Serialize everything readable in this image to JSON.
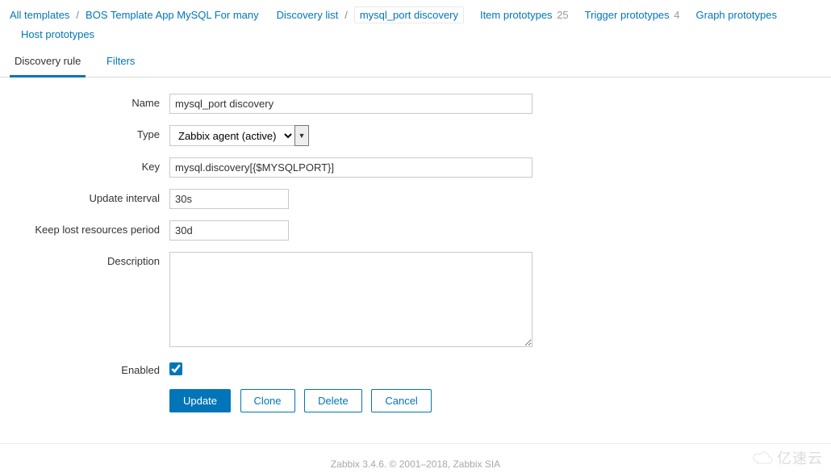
{
  "breadcrumb": {
    "all_templates": "All templates",
    "template_name": "BOS Template App MySQL For many",
    "discovery_list": "Discovery list",
    "current": "mysql_port discovery"
  },
  "nav": {
    "item_prototypes": {
      "label": "Item prototypes",
      "count": "25"
    },
    "trigger_prototypes": {
      "label": "Trigger prototypes",
      "count": "4"
    },
    "graph_prototypes": {
      "label": "Graph prototypes"
    },
    "host_prototypes": {
      "label": "Host prototypes"
    }
  },
  "tabs": {
    "discovery_rule": "Discovery rule",
    "filters": "Filters"
  },
  "form": {
    "labels": {
      "name": "Name",
      "type": "Type",
      "key": "Key",
      "update_interval": "Update interval",
      "keep_lost": "Keep lost resources period",
      "description": "Description",
      "enabled": "Enabled"
    },
    "values": {
      "name": "mysql_port discovery",
      "type": "Zabbix agent (active)",
      "key": "mysql.discovery[{$MYSQLPORT}]",
      "update_interval": "30s",
      "keep_lost": "30d",
      "description": "",
      "enabled": true
    }
  },
  "buttons": {
    "update": "Update",
    "clone": "Clone",
    "delete": "Delete",
    "cancel": "Cancel"
  },
  "footer": "Zabbix 3.4.6. © 2001–2018, Zabbix SIA",
  "watermark": "亿速云"
}
